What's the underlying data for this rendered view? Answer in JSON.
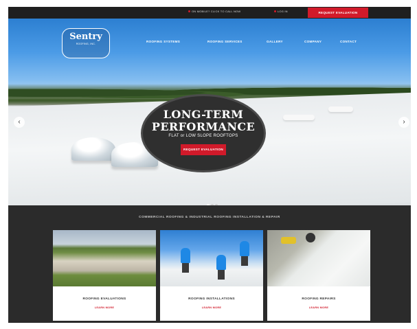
{
  "topbar": {
    "utility_left": "ON MOBILE? CLICK TO CALL NOW",
    "utility_right": "LOG IN",
    "cta": "REQUEST EVALUATION"
  },
  "logo": {
    "name": "Sentry",
    "sub": "ROOFING, INC."
  },
  "nav": {
    "items": [
      "ROOFING SYSTEMS",
      "ROOFING SERVICES",
      "GALLERY",
      "COMPANY",
      "CONTACT"
    ]
  },
  "hero": {
    "headline_1": "LONG-TERM",
    "headline_2": "PERFORMANCE",
    "subhead": "FLAT or LOW SLOPE ROOFTOPS",
    "button": "REQUEST EVALUATION",
    "prev_icon": "chevron-left-icon",
    "next_icon": "chevron-right-icon",
    "slides_total": 3,
    "slide_active": 1
  },
  "section": {
    "tagline": "COMMERCIAL ROOFING & INDUSTRIAL ROOFING INSTALLATION & REPAIR"
  },
  "cards": [
    {
      "title": "ROOFING EVALUATIONS",
      "link": "LEARN MORE"
    },
    {
      "title": "ROOFING INSTALLATIONS",
      "link": "LEARN MORE"
    },
    {
      "title": "ROOFING REPAIRS",
      "link": "LEARN MORE"
    }
  ],
  "colors": {
    "accent": "#d11a2a",
    "dark_bg": "#2b2b2b",
    "topbar_bg": "#1f1f1f"
  }
}
